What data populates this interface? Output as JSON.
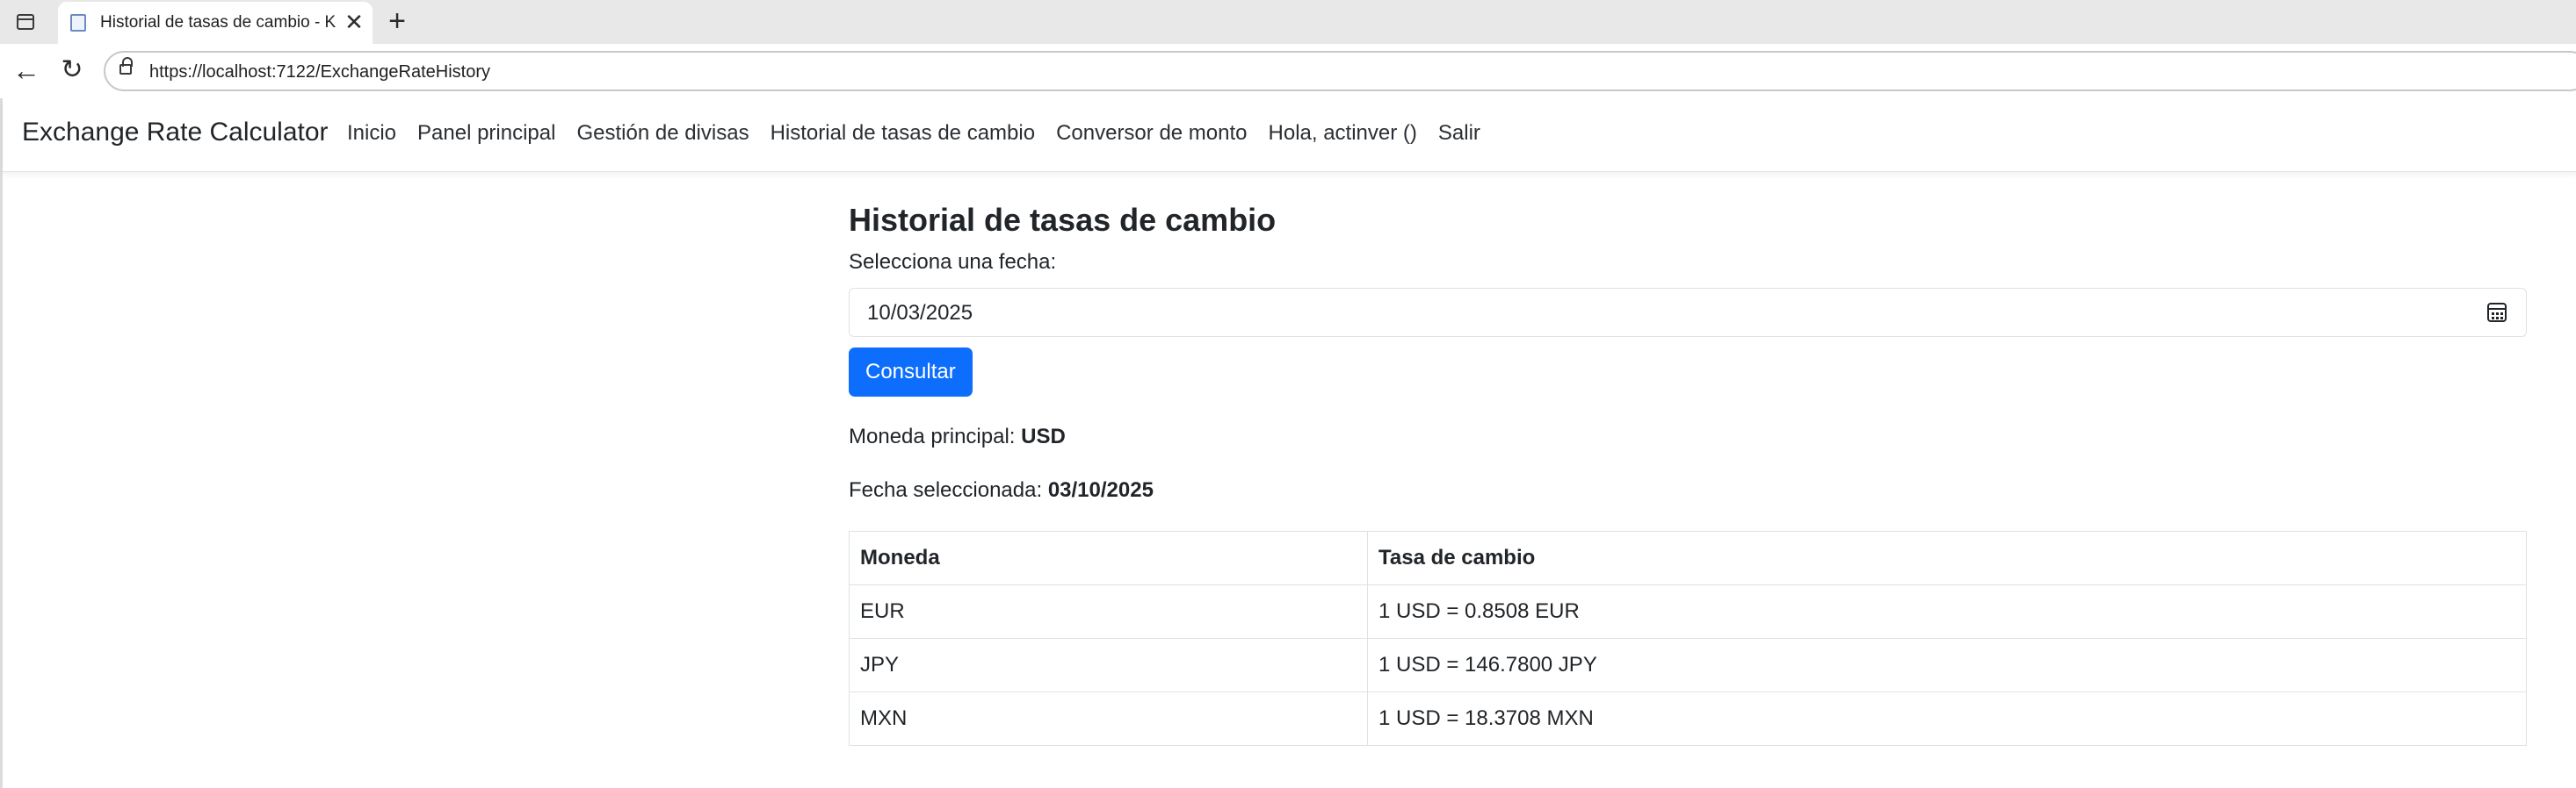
{
  "browser": {
    "tab_title": "Historial de tasas de cambio - KA",
    "tab_close": "✕",
    "new_tab": "+",
    "url": "https://localhost:7122/ExchangeRateHistory"
  },
  "nav": {
    "brand": "Exchange Rate Calculator",
    "links": [
      "Inicio",
      "Panel principal",
      "Gestión de divisas",
      "Historial de tasas de cambio",
      "Conversor de monto",
      "Hola, actinver ()",
      "Salir"
    ]
  },
  "main": {
    "title": "Historial de tasas de cambio",
    "date_label": "Selecciona una fecha:",
    "date_value": "10/03/2025",
    "submit_label": "Consultar",
    "principal_label": "Moneda principal: ",
    "principal_value": "USD",
    "selected_label": "Fecha seleccionada: ",
    "selected_value": "03/10/2025"
  },
  "table": {
    "headers": [
      "Moneda",
      "Tasa de cambio"
    ],
    "rows": [
      [
        "EUR",
        "1 USD = 0.8508 EUR"
      ],
      [
        "JPY",
        "1 USD = 146.7800 JPY"
      ],
      [
        "MXN",
        "1 USD = 18.3708 MXN"
      ]
    ]
  },
  "colors": {
    "primary_button": "#0d6efd",
    "text": "#212529",
    "border": "#dee2e6"
  }
}
